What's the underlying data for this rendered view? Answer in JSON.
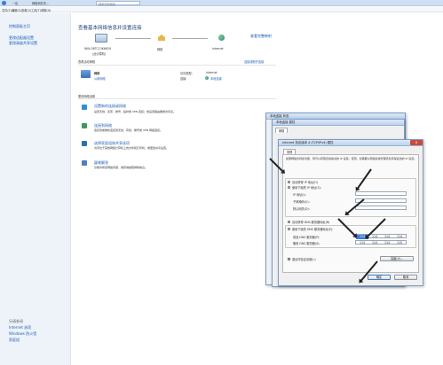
{
  "window": {
    "tabs": [
      "一区",
      "网络和共享...",
      "搜索控制面板"
    ],
    "menu": [
      "文件(F)",
      "编辑(E)",
      "查看(V)",
      "工具(T)",
      "帮助(H)"
    ]
  },
  "sidebar": {
    "title": "控制面板主页",
    "items": [
      "更改适配器设置",
      "更改高级共享设置"
    ],
    "see_also_title": "另请参阅",
    "see_also": [
      "Internet 选项",
      "Windows 防火墙",
      "家庭组"
    ]
  },
  "main": {
    "title": "查看基本网络信息并设置连接",
    "full_map_link": "查看完整映射",
    "map": {
      "computer_name": "WIN-36TC13K6K59",
      "computer_sub": "(此计算机)",
      "network_label": "网络",
      "internet_label": "Internet"
    },
    "active_networks_header": "查看活动网络",
    "connect_disconnect_link": "连接或断开连接",
    "network": {
      "name": "网络",
      "type": "公用网络",
      "access_type_label": "访问类型:",
      "access_type_value": "Internet",
      "connections_label": "连接:",
      "connections_value": "本地连接"
    },
    "change_settings_header": "更改网络设置",
    "tasks": [
      {
        "title": "设置新的连接或网络",
        "desc": "设置无线、宽带、拨号、临时或 VPN 连接；或设置路由器或访问点。",
        "color": "#2f8fd8"
      },
      {
        "title": "连接到网络",
        "desc": "连接到或重新连接到无线、有线、拨号或 VPN 网络连接。",
        "color": "#3c9a5a"
      },
      {
        "title": "选择家庭组和共享选项",
        "desc": "访问位于其他网络计算机上的文件和打印机，或更改共享设置。",
        "color": "#2c6fb7"
      },
      {
        "title": "疑难解答",
        "desc": "诊断并修复网络问题，或获得故障排除信息。",
        "color": "#4a7fc2"
      }
    ]
  },
  "dialog_back": {
    "title": "本地连接 状态",
    "subtitle": "本地连接 属性",
    "tab": "网络"
  },
  "dialog_ipv4": {
    "title": "Internet 协议版本 4 (TCP/IPv4) 属性",
    "close_label": "x",
    "tab": "常规",
    "description": "如果网络支持此功能，则可以获取自动指派的 IP 设置。否则，您需要从网络系统管理员处获得适当的 IP 设置。",
    "auto_ip": "自动获得 IP 地址(O)",
    "manual_ip": "使用下面的 IP 地址(S):",
    "ip_label": "IP 地址(I):",
    "mask_label": "子网掩码(U):",
    "gateway_label": "默认网关(D):",
    "auto_dns": "自动获得 DNS 服务器地址(B)",
    "manual_dns": "使用下面的 DNS 服务器地址(E):",
    "dns1_label": "首选 DNS 服务器(P):",
    "dns2_label": "备用 DNS 服务器(A):",
    "dns1": [
      "114",
      "114",
      "114",
      "114"
    ],
    "dns2": [
      "114",
      "114",
      "114",
      "115"
    ],
    "validate_label": "退出时验证设置(L)",
    "advanced_button": "高级(V)...",
    "ok_button": "确定",
    "cancel_button": "取消"
  }
}
